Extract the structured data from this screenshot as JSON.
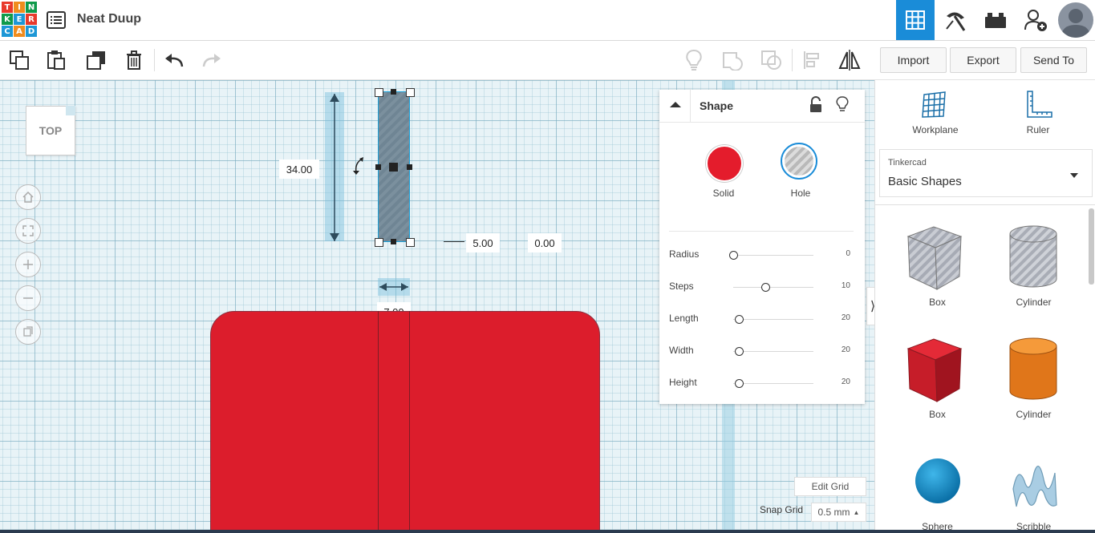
{
  "app": {
    "logo_letters": [
      "T",
      "I",
      "N",
      "K",
      "E",
      "R",
      "C",
      "A",
      "D"
    ],
    "logo_colors": [
      "#e8392b",
      "#f08c1e",
      "#0f9a4a",
      "#0f9a4a",
      "#1d97d6",
      "#e8392b",
      "#1d97d6",
      "#f08c1e",
      "#1d97d6"
    ],
    "design_title": "Neat Duup"
  },
  "topnav": {
    "icons": [
      "grid-view-icon",
      "build-pickaxe-icon",
      "bricks-icon",
      "invite-user-icon",
      "avatar"
    ],
    "accent": "#1a8cd8"
  },
  "toolbar": {
    "left_icons": [
      "copy-icon",
      "paste-icon",
      "duplicate-icon",
      "delete-icon",
      "undo-icon",
      "redo-icon"
    ],
    "right_icons": [
      "light-bulb-icon",
      "group-icon",
      "ungroup-icon",
      "align-icon",
      "mirror-icon"
    ],
    "import_label": "Import",
    "export_label": "Export",
    "sendto_label": "Send To"
  },
  "viewcube": {
    "label": "TOP"
  },
  "workplane": {
    "dim_height": "34.00",
    "dim_x": "5.00",
    "dim_y": "0.00",
    "dim_width": "7.00",
    "box_color": "#dc1d2c"
  },
  "shape_panel": {
    "title": "Shape",
    "solid_label": "Solid",
    "hole_label": "Hole",
    "solid_color": "#e41c2c",
    "params": [
      {
        "label": "Radius",
        "value": "0",
        "level": 0
      },
      {
        "label": "Steps",
        "value": "10",
        "level": 0.4
      },
      {
        "label": "Length",
        "value": "20",
        "level": 0.07
      },
      {
        "label": "Width",
        "value": "20",
        "level": 0.07
      },
      {
        "label": "Height",
        "value": "20",
        "level": 0.07
      }
    ]
  },
  "right_panel": {
    "workplane_label": "Workplane",
    "ruler_label": "Ruler",
    "library_source": "Tinkercad",
    "library_name": "Basic Shapes",
    "shapes": [
      {
        "label": "Box",
        "kind": "box-hole"
      },
      {
        "label": "Cylinder",
        "kind": "cylinder-hole"
      },
      {
        "label": "Box",
        "kind": "box-solid"
      },
      {
        "label": "Cylinder",
        "kind": "cylinder-solid"
      },
      {
        "label": "Sphere",
        "kind": "sphere"
      },
      {
        "label": "Scribble",
        "kind": "scribble"
      }
    ]
  },
  "grid": {
    "edit_grid_label": "Edit Grid",
    "snap_label": "Snap Grid",
    "snap_value": "0.5 mm"
  }
}
